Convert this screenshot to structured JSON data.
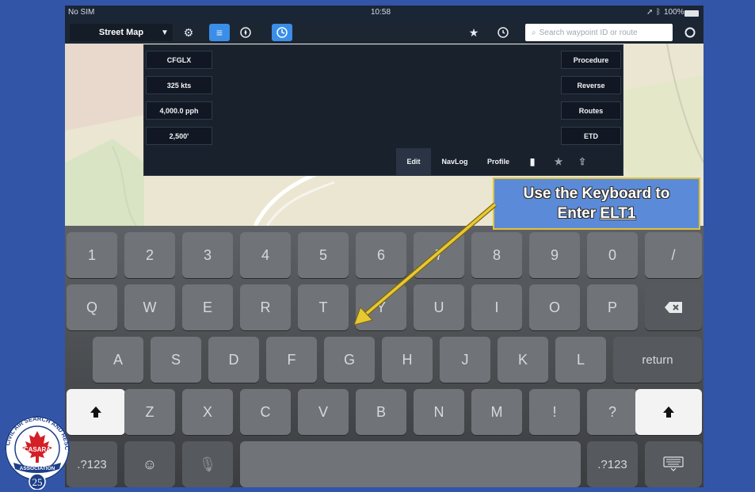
{
  "status_bar": {
    "carrier": "No SIM",
    "time": "10:58",
    "battery": "100%"
  },
  "toolbar": {
    "layer": "Street Map",
    "search_placeholder": "Search waypoint ID or route"
  },
  "flight_plan": {
    "left_fields": [
      "CFGLX",
      "325 kts",
      "4,000.0 pph",
      "2,500'"
    ],
    "right_buttons": [
      "Procedure",
      "Reverse",
      "Routes",
      "ETD"
    ],
    "tabs": [
      "Edit",
      "NavLog",
      "Profile"
    ]
  },
  "keyboard": {
    "row1": [
      "1",
      "2",
      "3",
      "4",
      "5",
      "6",
      "7",
      "8",
      "9",
      "0",
      "/"
    ],
    "row2": [
      "Q",
      "W",
      "E",
      "R",
      "T",
      "Y",
      "U",
      "I",
      "O",
      "P"
    ],
    "row3": [
      "A",
      "S",
      "D",
      "F",
      "G",
      "H",
      "J",
      "K",
      "L"
    ],
    "return_label": "return",
    "row4": [
      "Z",
      "X",
      "C",
      "V",
      "B",
      "N",
      "M",
      "!",
      "?"
    ],
    "numbers_label": ".?123"
  },
  "callout": {
    "line1": "Use the Keyboard to",
    "line2_prefix": "Enter ",
    "line2_code": "ELT1"
  },
  "logo": {
    "top_text": "CIVIL AIR SEARCH AND RESCUE",
    "center_text": "CASARA",
    "bottom_text": "ASSOCIATION",
    "number": "25"
  },
  "colors": {
    "slide_bg": "#3355a8",
    "callout_bg": "#5b8bd8",
    "callout_border": "#e0c23c",
    "active_button": "#3a8ee8"
  },
  "icons": [
    "gear-icon",
    "list-icon",
    "compass-icon",
    "clock-icon",
    "star-icon",
    "history-icon",
    "search-icon",
    "sync-icon",
    "briefcase-icon",
    "share-icon",
    "shift-icon",
    "backspace-icon",
    "emoji-icon",
    "mic-icon",
    "hide-keyboard-icon"
  ]
}
